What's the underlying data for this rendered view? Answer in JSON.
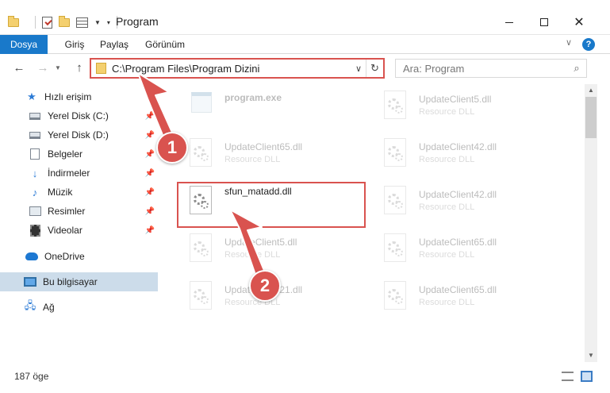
{
  "window": {
    "title": "Program",
    "minimize_label": "",
    "maximize_label": "",
    "close_label": "✕"
  },
  "ribbon": {
    "tabs": [
      "Dosya",
      "Giriş",
      "Paylaş",
      "Görünüm"
    ],
    "help": "?"
  },
  "address_bar": {
    "path": "C:\\Program Files\\Program Dizini",
    "refresh_icon": "refresh-icon",
    "dropdown_icon": "chevron-down-icon"
  },
  "search": {
    "placeholder": "Ara: Program"
  },
  "sidebar": {
    "quick_access": "Hızlı erişim",
    "items": [
      {
        "label": "Yerel Disk (C:)",
        "icon": "drive-icon",
        "pinned": true
      },
      {
        "label": "Yerel Disk (D:)",
        "icon": "drive-icon",
        "pinned": true
      },
      {
        "label": "Belgeler",
        "icon": "documents-icon",
        "pinned": true
      },
      {
        "label": "İndirmeler",
        "icon": "download-icon",
        "pinned": true
      },
      {
        "label": "Müzik",
        "icon": "music-icon",
        "pinned": true
      },
      {
        "label": "Resimler",
        "icon": "pictures-icon",
        "pinned": true
      },
      {
        "label": "Videolar",
        "icon": "videos-icon",
        "pinned": true
      }
    ],
    "onedrive": "OneDrive",
    "this_pc": "Bu bilgisayar",
    "network": "Ağ"
  },
  "files": [
    {
      "name": "program.exe",
      "desc": "",
      "faded": true
    },
    {
      "name": "UpdateClient5.dll",
      "desc": "Resource DLL",
      "faded": true
    },
    {
      "name": "UpdateClient65.dll",
      "desc": "Resource DLL",
      "faded": true
    },
    {
      "name": "UpdateClient42.dll",
      "desc": "Resource DLL",
      "faded": true
    },
    {
      "name": "sfun_matadd.dll",
      "desc": "",
      "faded": false
    },
    {
      "name": "UpdateClient42.dll",
      "desc": "Resource DLL",
      "faded": true
    },
    {
      "name": "UpdateClient5.dll",
      "desc": "Resource DLL",
      "faded": true
    },
    {
      "name": "UpdateClient65.dll",
      "desc": "Resource DLL",
      "faded": true
    },
    {
      "name": "UpdateClient21.dll",
      "desc": "Resource DLL",
      "faded": true
    },
    {
      "name": "UpdateClient65.dll",
      "desc": "Resource DLL",
      "faded": true
    }
  ],
  "status": {
    "item_count": "187 öge"
  },
  "annotations": {
    "step1": "1",
    "step2": "2",
    "color": "#d9534f"
  },
  "colors": {
    "accent": "#1979ca",
    "selected": "#ccdcea"
  }
}
